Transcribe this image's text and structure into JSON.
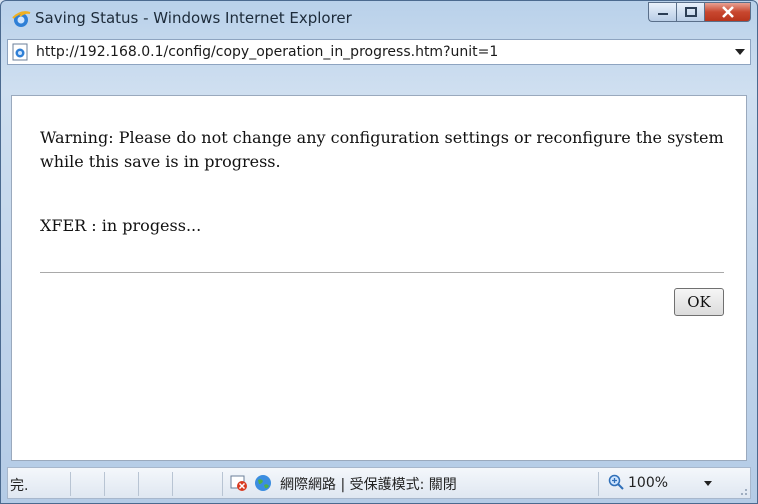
{
  "window": {
    "title": "Saving Status - Windows Internet Explorer",
    "address": "http://192.168.0.1/config/copy_operation_in_progress.htm?unit=1"
  },
  "content": {
    "warning": "Warning: Please do not change any configuration settings or reconfigure the system while this save is in progress.",
    "status": "XFER : in progess...",
    "ok_label": "OK"
  },
  "statusbar": {
    "done": "完.",
    "zone": "網際網路 | 受保護模式: 關閉",
    "zoom": "100%"
  },
  "icons": {
    "ie": "ie-logo-icon",
    "page": "page-icon",
    "blocked": "popup-blocked-icon",
    "globe": "internet-zone-icon",
    "zoom": "zoom-icon"
  }
}
